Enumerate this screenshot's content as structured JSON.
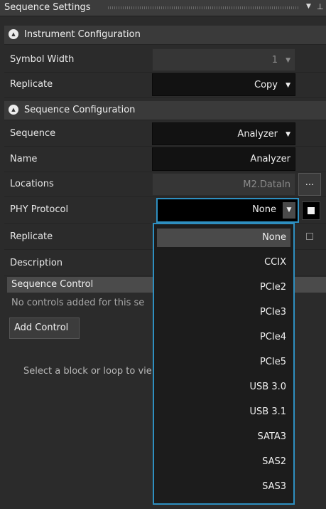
{
  "panel": {
    "title": "Sequence Settings",
    "dropdown_glyph": "▼",
    "pin_glyph": "⊥"
  },
  "instrument_config": {
    "header": "Instrument Configuration",
    "collapse_glyph": "▲",
    "symbol_width": {
      "label": "Symbol Width",
      "value": "1"
    },
    "replicate": {
      "label": "Replicate",
      "value": "Copy"
    }
  },
  "sequence_config": {
    "header": "Sequence Configuration",
    "collapse_glyph": "▲",
    "sequence": {
      "label": "Sequence",
      "value": "Analyzer"
    },
    "name": {
      "label": "Name",
      "value": "Analyzer"
    },
    "locations": {
      "label": "Locations",
      "value": "M2.DataIn",
      "browse_label": "..."
    },
    "phy_protocol": {
      "label": "PHY Protocol",
      "value": "None",
      "checked": true
    },
    "replicate": {
      "label": "Replicate",
      "checked": false
    },
    "description": {
      "label": "Description"
    }
  },
  "sequence_control": {
    "header": "Sequence Control",
    "empty_text": "No controls added for this se",
    "add_button": "Add Control",
    "hint": "Select a block or loop to vie"
  },
  "phy_dropdown": {
    "selected": "None",
    "options": [
      "None",
      "CCIX",
      "PCIe2",
      "PCIe3",
      "PCIe4",
      "PCIe5",
      "USB 3.0",
      "USB 3.1",
      "SATA3",
      "SAS2",
      "SAS3"
    ]
  },
  "colors": {
    "panel_bg": "#2b2b2b",
    "accent_border": "#2e8fc0",
    "dropdown_bg": "#1c1c1c",
    "selected_option_bg": "#4a4a4a"
  },
  "icons": {
    "collapse": "chevron-up-icon",
    "dropdown": "caret-down-icon",
    "pin": "pin-icon",
    "checkbox": "checkbox-icon"
  }
}
